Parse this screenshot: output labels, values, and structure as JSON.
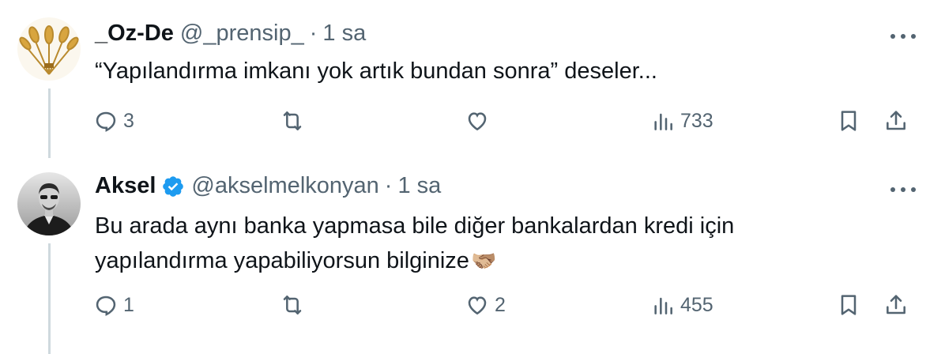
{
  "tweets": [
    {
      "name": "_Oz-De",
      "handle": "@_prensip_",
      "separator": "·",
      "time": "1 sa",
      "text": "“Yapılandırma imkanı yok artık bundan sonra” deseler...",
      "replies": "3",
      "reposts": "",
      "likes": "",
      "views": "733",
      "avatar_icon": "wheat-icon",
      "verified": false
    },
    {
      "name": "Aksel",
      "handle": "@akselmelkonyan",
      "separator": "·",
      "time": "1 sa",
      "text_line1": "Bu arada aynı banka yapmasa bile diğer bankalardan kredi için",
      "text_line2": "yapılandırma yapabiliyorsun bilginize",
      "emoji": "🫱🏼‍🫲🏽",
      "replies": "1",
      "reposts": "",
      "likes": "2",
      "views": "455",
      "avatar_icon": "person-photo",
      "verified": true
    }
  ],
  "colors": {
    "text": "#0f1419",
    "muted": "#536471",
    "verified": "#1d9bf0",
    "thread_line": "#cfd9de"
  }
}
